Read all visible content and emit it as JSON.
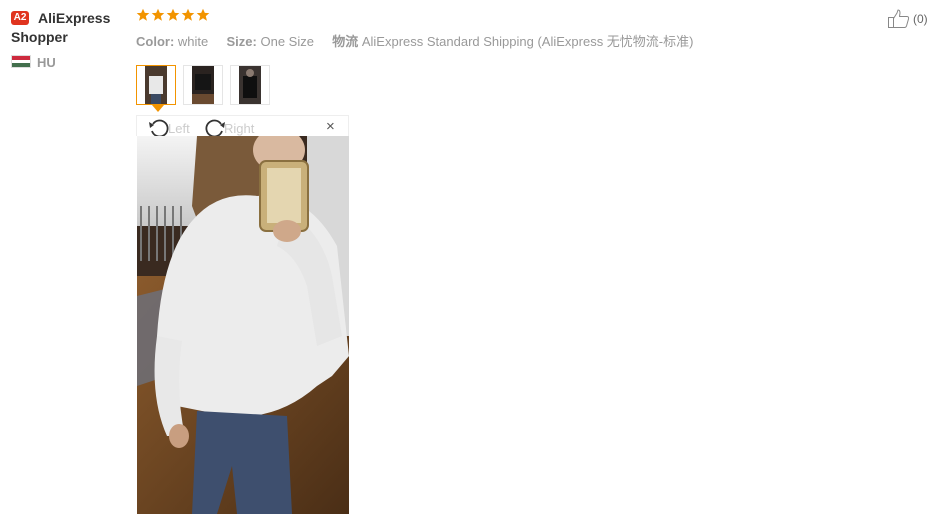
{
  "user": {
    "badge": "A2",
    "name": "AliExpress Shopper",
    "country": "HU",
    "flag_colors": [
      "#cd2a3e",
      "#ffffff",
      "#436f4d"
    ]
  },
  "review": {
    "rating": 5,
    "max_rating": 5,
    "star_color": "#f29400",
    "attributes": [
      {
        "key": "Color:",
        "value": "white"
      },
      {
        "key": "Size:",
        "value": "One Size"
      },
      {
        "key": "物流",
        "value": "AliExpress Standard Shipping (AliExpress 无忧物流-标准)"
      }
    ],
    "likes": "(0)"
  },
  "viewer": {
    "rotate_left": "Left",
    "rotate_right": "Right",
    "close": "×"
  },
  "icons": {
    "like": "thumbs-up-icon",
    "rotate_left": "rotate-left-icon",
    "rotate_right": "rotate-right-icon",
    "close": "close-icon"
  }
}
